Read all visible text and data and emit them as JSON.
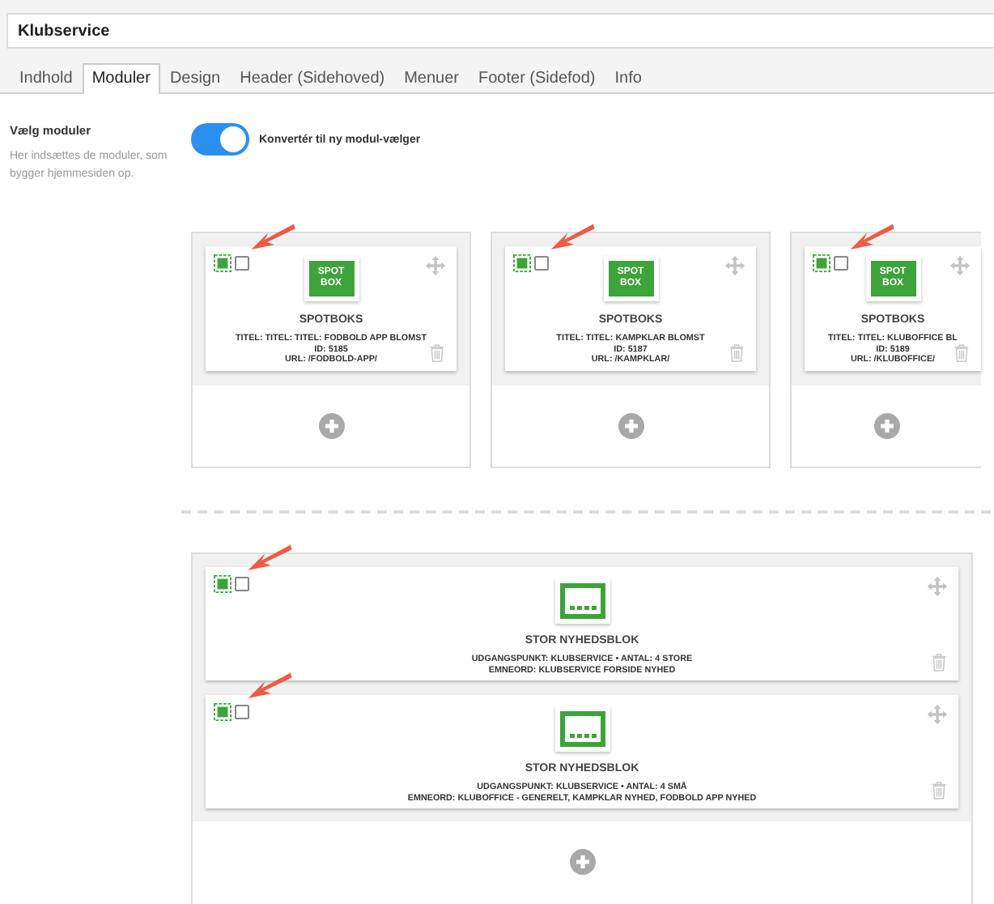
{
  "title_field": {
    "value": "Klubservice"
  },
  "tabs": [
    {
      "label": "Indhold",
      "selected": false
    },
    {
      "label": "Moduler",
      "selected": true
    },
    {
      "label": "Design",
      "selected": false
    },
    {
      "label": "Header (Sidehoved)",
      "selected": false
    },
    {
      "label": "Menuer",
      "selected": false
    },
    {
      "label": "Footer (Sidefod)",
      "selected": false
    },
    {
      "label": "Info",
      "selected": false
    }
  ],
  "section": {
    "heading": "Vælg moduler",
    "description": "Her indsættes de moduler, som bygger hjemmesiden op."
  },
  "toggle": {
    "label": "Konvertér til ny modul-vælger",
    "on": true
  },
  "spot_columns": [
    {
      "module": {
        "kind": "spotbox",
        "logo_text": [
          "SPOT",
          "BOX"
        ],
        "title": "SPOTBOKS",
        "lines": [
          "TITEL: TITEL: TITEL: FODBOLD APP BLOMST",
          "ID: 5185",
          "URL: /FODBOLD-APP/"
        ],
        "checked": false,
        "arrow": true
      }
    },
    {
      "module": {
        "kind": "spotbox",
        "logo_text": [
          "SPOT",
          "BOX"
        ],
        "title": "SPOTBOKS",
        "lines": [
          "TITEL: TITEL: KAMPKLAR BLOMST",
          "ID: 5187",
          "URL: /KAMPKLAR/"
        ],
        "checked": false,
        "arrow": true
      }
    },
    {
      "module": {
        "kind": "spotbox",
        "logo_text": [
          "SPOT",
          "BOX"
        ],
        "title": "SPOTBOKS",
        "lines": [
          "TITEL: TITEL: KLUBOFFICE BL",
          "ID: 5189",
          "URL: /KLUBOFFICE/"
        ],
        "checked": false,
        "arrow": true
      }
    }
  ],
  "news_modules": [
    {
      "kind": "news",
      "title": "STOR NYHEDSBLOK",
      "lines": [
        "UDGANGSPUNKT: KLUBSERVICE • ANTAL: 4 STORE",
        "EMNEORD: KLUBSERVICE FORSIDE NYHED"
      ],
      "checked": false,
      "arrow": true
    },
    {
      "kind": "news",
      "title": "STOR NYHEDSBLOK",
      "lines": [
        "UDGANGSPUNKT: KLUBSERVICE • ANTAL: 4 SMÅ",
        "EMNEORD: KLUBOFFICE - GENERELT, KAMPKLAR NYHED, FODBOLD APP NYHED"
      ],
      "checked": false,
      "arrow": true
    }
  ]
}
